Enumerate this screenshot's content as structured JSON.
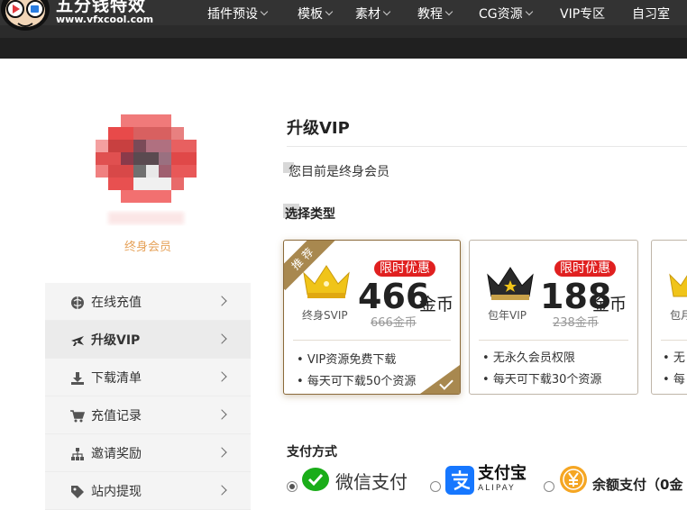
{
  "header": {
    "logo_title": "五分钱特效",
    "logo_url": "www.vfxcool.com",
    "nav": [
      {
        "label": "插件预设",
        "dropdown": true
      },
      {
        "label": "模板",
        "dropdown": true
      },
      {
        "label": "素材",
        "dropdown": true
      },
      {
        "label": "教程",
        "dropdown": true
      },
      {
        "label": "CG资源",
        "dropdown": true
      },
      {
        "label": "VIP专区",
        "dropdown": false
      },
      {
        "label": "自习室",
        "dropdown": false
      }
    ]
  },
  "profile": {
    "member_level": "终身会员"
  },
  "sidebar": {
    "items": [
      {
        "label": "在线充值",
        "icon": "globe-icon",
        "active": false
      },
      {
        "label": "升级VIP",
        "icon": "plane-icon",
        "active": true
      },
      {
        "label": "下载清单",
        "icon": "download-icon",
        "active": false
      },
      {
        "label": "充值记录",
        "icon": "cart-icon",
        "active": false
      },
      {
        "label": "邀请奖励",
        "icon": "org-chart-icon",
        "active": false
      },
      {
        "label": "站内提现",
        "icon": "tag-icon",
        "active": false
      }
    ]
  },
  "main": {
    "title": "升级VIP",
    "status": "您目前是终身会员",
    "type_label": "选择类型",
    "cards": [
      {
        "ribbon": "推荐",
        "plan": "终身SVIP",
        "promo": "限时优惠",
        "price": "466",
        "unit": "金币",
        "old_price": "666金币",
        "features": [
          "VIP资源免费下载",
          "每天可下载50个资源"
        ],
        "selected": true,
        "crown_color": "#f0c419"
      },
      {
        "plan": "包年VIP",
        "promo": "限时优惠",
        "price": "188",
        "unit": "金币",
        "old_price": "238金币",
        "features": [
          "无永久会员权限",
          "每天可下载30个资源"
        ],
        "selected": false,
        "crown_color": "#2a2a2a"
      },
      {
        "plan": "包月",
        "features": [
          "无",
          "每"
        ],
        "selected": false,
        "crown_color": "#f0c419"
      }
    ]
  },
  "payment": {
    "label": "支付方式",
    "options": [
      {
        "label": "微信支付",
        "icon": "wechat-icon",
        "checked": true
      },
      {
        "label": "支付宝",
        "sublabel": "ALIPAY",
        "icon": "alipay-icon",
        "checked": false
      },
      {
        "label": "余额支付（0金",
        "icon": "yuan-coin-icon",
        "checked": false
      }
    ]
  },
  "colors": {
    "accent_gold": "#a8884f",
    "promo_red": "#e02020",
    "member_orange": "#e6a25a",
    "wechat_green": "#1aad19",
    "alipay_blue": "#1677ff"
  }
}
